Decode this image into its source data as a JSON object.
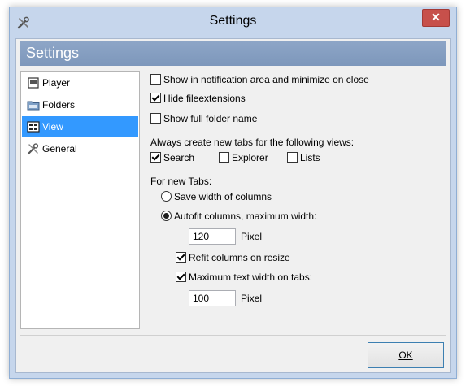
{
  "window": {
    "title": "Settings",
    "close_glyph": "✕"
  },
  "header": {
    "title": "Settings"
  },
  "nav": {
    "items": [
      {
        "label": "Player",
        "icon": "player-icon",
        "selected": false
      },
      {
        "label": "Folders",
        "icon": "folders-icon",
        "selected": false
      },
      {
        "label": "View",
        "icon": "view-icon",
        "selected": true
      },
      {
        "label": "General",
        "icon": "general-icon",
        "selected": false
      }
    ]
  },
  "options": {
    "show_notification": {
      "label": "Show in notification area and minimize on close",
      "checked": false
    },
    "hide_extensions": {
      "label": "Hide fileextensions",
      "checked": true
    },
    "show_full_folder": {
      "label": "Show full folder name",
      "checked": false
    }
  },
  "tabs_views": {
    "label": "Always create new tabs for the following views:",
    "search": {
      "label": "Search",
      "checked": true
    },
    "explorer": {
      "label": "Explorer",
      "checked": false
    },
    "lists": {
      "label": "Lists",
      "checked": false
    }
  },
  "new_tabs": {
    "label": "For new Tabs:",
    "save_width": {
      "label": "Save width of columns",
      "selected": false
    },
    "autofit": {
      "label": "Autofit columns, maximum width:",
      "selected": true
    },
    "max_width_value": "120",
    "pixel_label_1": "Pixel",
    "refit": {
      "label": "Refit columns on resize",
      "checked": true
    },
    "max_text": {
      "label": "Maximum text width on tabs:",
      "checked": true
    },
    "max_text_value": "100",
    "pixel_label_2": "Pixel"
  },
  "footer": {
    "ok_label": "OK"
  },
  "colors": {
    "accent": "#3399ff",
    "header_bg": "#8ea6c7",
    "frame": "#c6d6ec",
    "close": "#c7504b"
  }
}
